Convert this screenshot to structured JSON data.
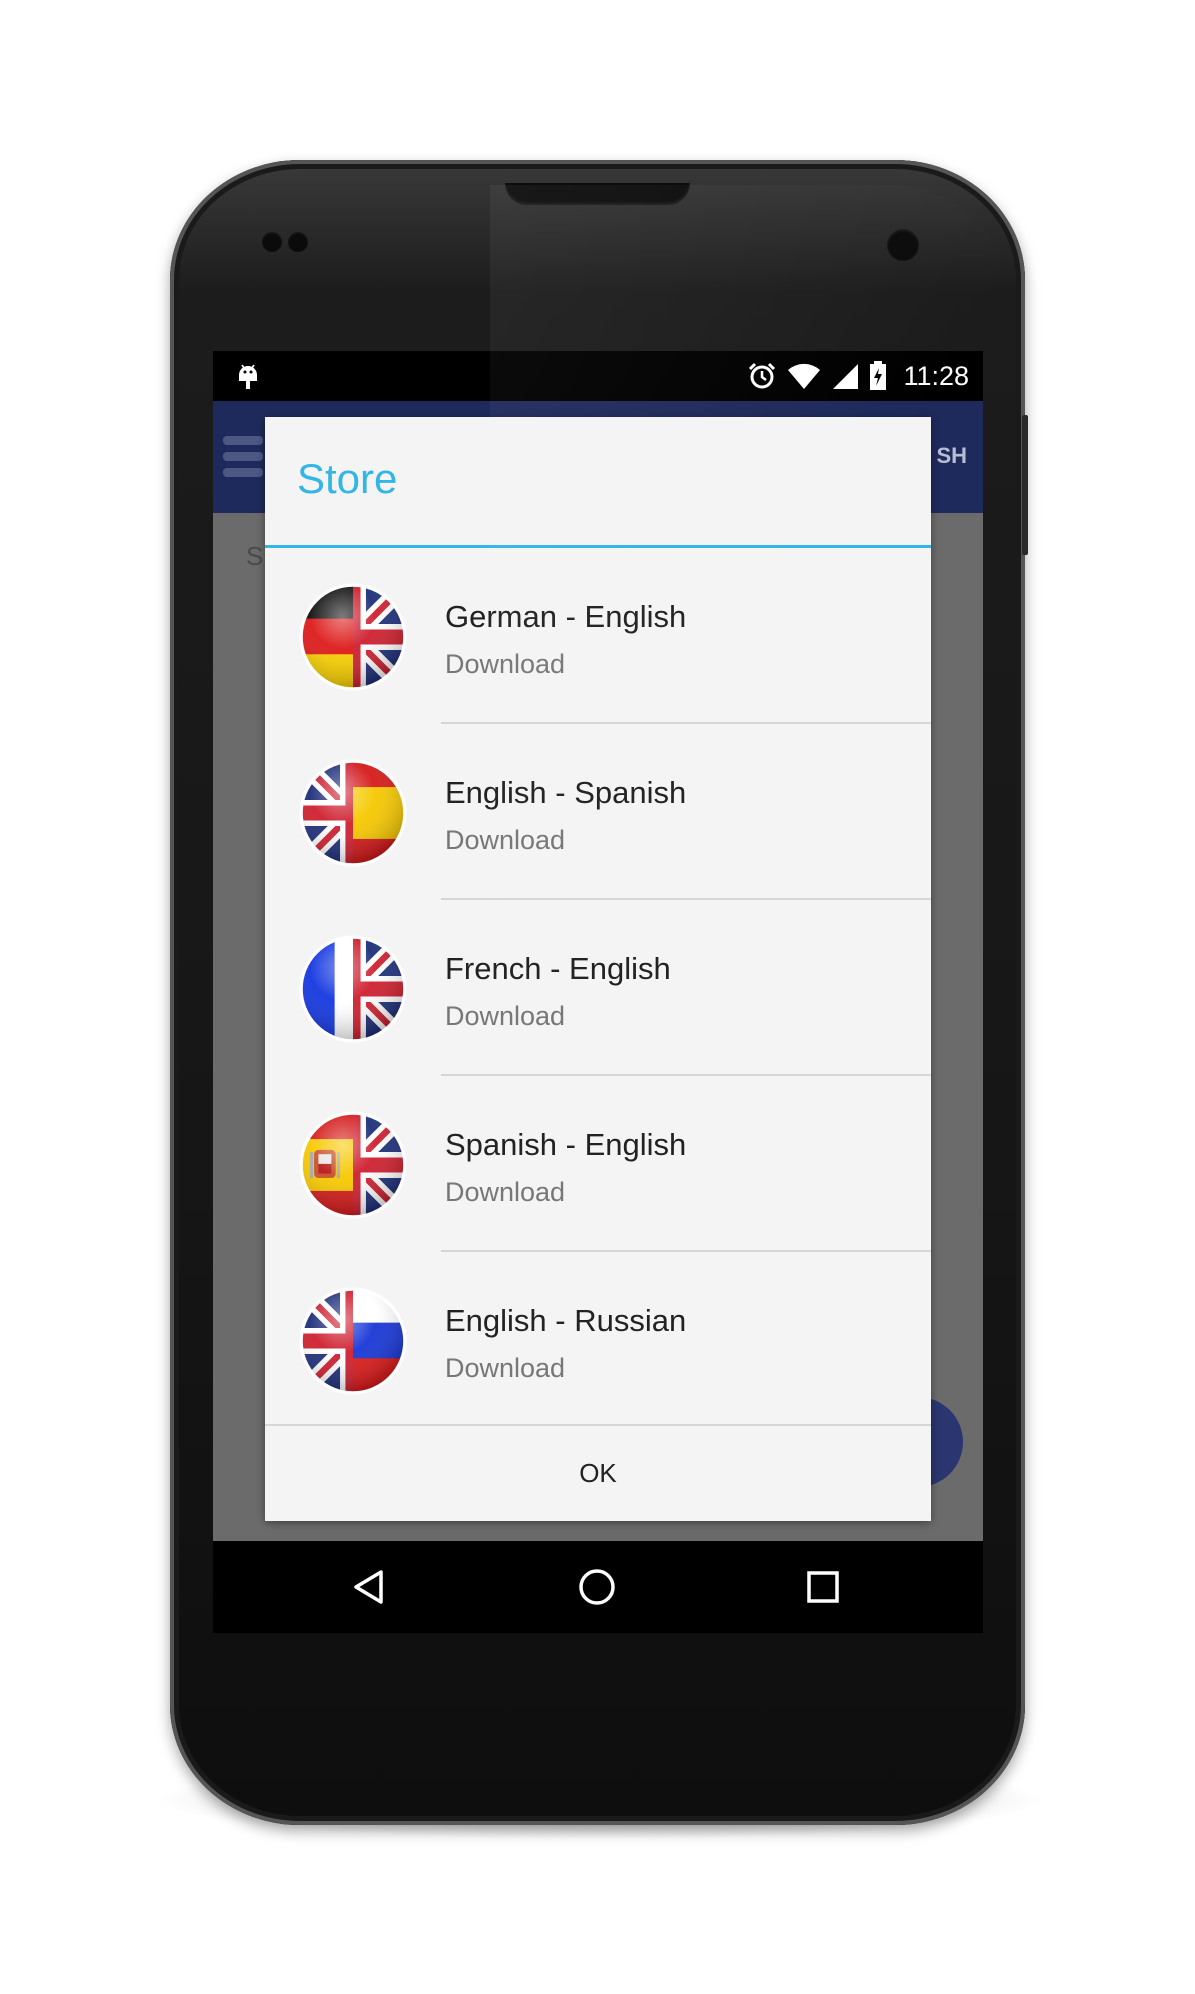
{
  "status_bar": {
    "time": "11:28",
    "icons": [
      "android-debug-icon",
      "alarm-clock-icon",
      "wifi-icon",
      "cell-signal-icon",
      "battery-charging-icon"
    ]
  },
  "app_bar": {
    "partial_title": "SH",
    "color": "#1f2a5c"
  },
  "background_content": {
    "partial_text": "S"
  },
  "dialog": {
    "title": "Store",
    "accent_color": "#33b5e5",
    "items": [
      {
        "title": "German - English",
        "status": "Download",
        "flag_left": "germany",
        "flag_right": "united-kingdom"
      },
      {
        "title": "English - Spanish",
        "status": "Download",
        "flag_left": "united-kingdom",
        "flag_right": "spain"
      },
      {
        "title": "French - English",
        "status": "Download",
        "flag_left": "france",
        "flag_right": "united-kingdom"
      },
      {
        "title": "Spanish - English",
        "status": "Download",
        "flag_left": "spain",
        "flag_right": "united-kingdom"
      },
      {
        "title": "English - Russian",
        "status": "Download",
        "flag_left": "united-kingdom",
        "flag_right": "russia"
      }
    ],
    "ok_label": "OK"
  },
  "nav_bar": {
    "icons": [
      "back-icon",
      "home-icon",
      "recents-icon"
    ]
  }
}
